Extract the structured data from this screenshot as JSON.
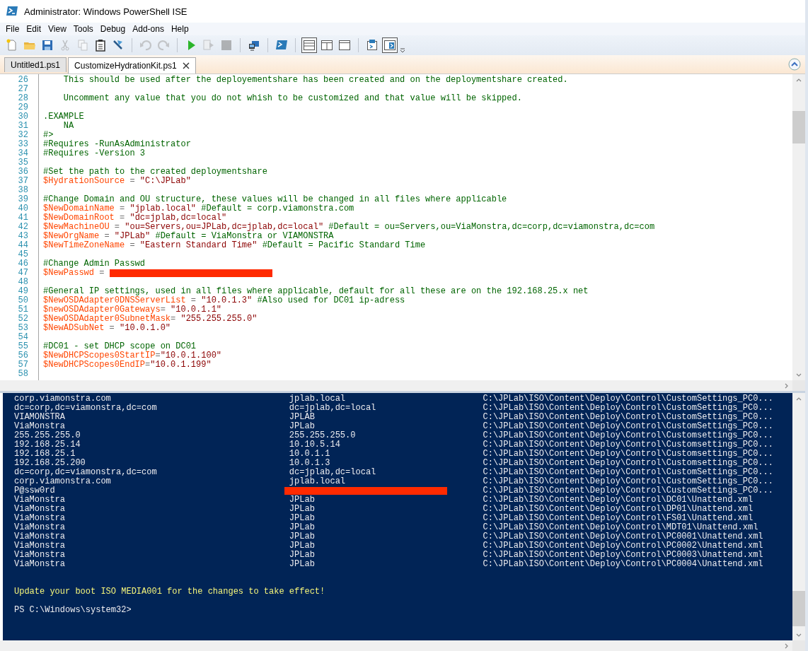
{
  "window": {
    "title": "Administrator: Windows PowerShell ISE"
  },
  "menu": [
    "File",
    "Edit",
    "View",
    "Tools",
    "Debug",
    "Add-ons",
    "Help"
  ],
  "toolbar": [
    {
      "kind": "new",
      "disabled": false,
      "pressed": false
    },
    {
      "kind": "open",
      "disabled": false,
      "pressed": false
    },
    {
      "kind": "save",
      "disabled": false,
      "pressed": false
    },
    {
      "kind": "cut",
      "disabled": true,
      "pressed": false
    },
    {
      "kind": "copy",
      "disabled": true,
      "pressed": false
    },
    {
      "kind": "paste",
      "disabled": false,
      "pressed": false
    },
    {
      "kind": "clear",
      "disabled": false,
      "pressed": false
    },
    {
      "kind": "separator"
    },
    {
      "kind": "undo",
      "disabled": true,
      "pressed": false
    },
    {
      "kind": "redo",
      "disabled": true,
      "pressed": false
    },
    {
      "kind": "separator"
    },
    {
      "kind": "run",
      "disabled": false,
      "pressed": false
    },
    {
      "kind": "run-selection",
      "disabled": true,
      "pressed": false
    },
    {
      "kind": "stop",
      "disabled": true,
      "pressed": false
    },
    {
      "kind": "separator"
    },
    {
      "kind": "remote",
      "disabled": false,
      "pressed": false
    },
    {
      "kind": "separator"
    },
    {
      "kind": "console",
      "disabled": false,
      "pressed": false
    },
    {
      "kind": "separator"
    },
    {
      "kind": "layout-top",
      "disabled": false,
      "pressed": true
    },
    {
      "kind": "layout-right",
      "disabled": false,
      "pressed": false
    },
    {
      "kind": "layout-max",
      "disabled": false,
      "pressed": false
    },
    {
      "kind": "separator"
    },
    {
      "kind": "show-script",
      "disabled": false,
      "pressed": false
    },
    {
      "kind": "show-addon",
      "disabled": false,
      "pressed": true
    },
    {
      "kind": "overflow"
    }
  ],
  "tabs": [
    {
      "label": "Untitled1.ps1",
      "selected": false,
      "closable": false
    },
    {
      "label": "CustomizeHydrationKit.ps1",
      "selected": true,
      "closable": true
    }
  ],
  "editor": {
    "lines": [
      {
        "number": "26",
        "tokens": [
          {
            "kind": "comment",
            "text": "    This should be used after the deployementshare has been created and on the deploymentshare created."
          }
        ]
      },
      {
        "number": "27"
      },
      {
        "number": "28",
        "tokens": [
          {
            "kind": "comment",
            "text": "    Uncomment any value that you do not whish to be customized and that value will be skipped."
          }
        ]
      },
      {
        "number": "29"
      },
      {
        "number": "30",
        "tokens": [
          {
            "kind": "comment",
            "text": ".EXAMPLE"
          }
        ]
      },
      {
        "number": "31",
        "tokens": [
          {
            "kind": "comment",
            "text": "    NA"
          }
        ]
      },
      {
        "number": "32",
        "tokens": [
          {
            "kind": "comment",
            "text": "#>"
          }
        ]
      },
      {
        "number": "33",
        "tokens": [
          {
            "kind": "comment",
            "text": "#Requires -RunAsAdministrator"
          }
        ]
      },
      {
        "number": "34",
        "tokens": [
          {
            "kind": "comment",
            "text": "#Requires -Version 3"
          }
        ]
      },
      {
        "number": "35"
      },
      {
        "number": "36",
        "tokens": [
          {
            "kind": "comment",
            "text": "#Set the path to the created deploymentshare"
          }
        ]
      },
      {
        "number": "37",
        "tokens": [
          {
            "kind": "variable",
            "text": "$HydrationSource"
          },
          {
            "kind": "operator",
            "text": " = "
          },
          {
            "kind": "string",
            "text": "\"C:\\JPLab\""
          }
        ]
      },
      {
        "number": "38"
      },
      {
        "number": "39",
        "tokens": [
          {
            "kind": "comment",
            "text": "#Change Domain and OU structure, these values will be changed in all files where applicable"
          }
        ]
      },
      {
        "number": "40",
        "tokens": [
          {
            "kind": "variable",
            "text": "$NewDomainName"
          },
          {
            "kind": "operator",
            "text": " = "
          },
          {
            "kind": "string",
            "text": "\"jplab.local\""
          },
          {
            "kind": "comment",
            "text": " #Default = corp.viamonstra.com"
          }
        ]
      },
      {
        "number": "41",
        "tokens": [
          {
            "kind": "variable",
            "text": "$NewDomainRoot"
          },
          {
            "kind": "operator",
            "text": " = "
          },
          {
            "kind": "string",
            "text": "\"dc=jplab,dc=local\""
          }
        ]
      },
      {
        "number": "42",
        "tokens": [
          {
            "kind": "variable",
            "text": "$NewMachineOU"
          },
          {
            "kind": "operator",
            "text": " = "
          },
          {
            "kind": "string",
            "text": "\"ou=Servers,ou=JPLab,dc=jplab,dc=local\""
          },
          {
            "kind": "comment",
            "text": " #Default = ou=Servers,ou=ViaMonstra,dc=corp,dc=viamonstra,dc=com"
          }
        ]
      },
      {
        "number": "43",
        "tokens": [
          {
            "kind": "variable",
            "text": "$NewOrgName"
          },
          {
            "kind": "operator",
            "text": " = "
          },
          {
            "kind": "string",
            "text": "\"JPLab\""
          },
          {
            "kind": "comment",
            "text": " #Default = ViaMonstra or VIAMONSTRA"
          }
        ]
      },
      {
        "number": "44",
        "tokens": [
          {
            "kind": "variable",
            "text": "$NewTimeZoneName"
          },
          {
            "kind": "operator",
            "text": " = "
          },
          {
            "kind": "string",
            "text": "\"Eastern Standard Time\""
          },
          {
            "kind": "comment",
            "text": " #Default = Pacific Standard Time"
          }
        ]
      },
      {
        "number": "45"
      },
      {
        "number": "46",
        "tokens": [
          {
            "kind": "comment",
            "text": "#Change Admin Passwd"
          }
        ]
      },
      {
        "number": "47",
        "tokens": [
          {
            "kind": "variable",
            "text": "$NewPasswd"
          },
          {
            "kind": "operator",
            "text": " = "
          },
          {
            "kind": "redaction"
          }
        ]
      },
      {
        "number": "48"
      },
      {
        "number": "49",
        "tokens": [
          {
            "kind": "comment",
            "text": "#General IP settings, used in all files where applicable, default for all these are on the 192.168.25.x net"
          }
        ]
      },
      {
        "number": "50",
        "tokens": [
          {
            "kind": "variable",
            "text": "$NewOSDAdapter0DNSServerList"
          },
          {
            "kind": "operator",
            "text": " = "
          },
          {
            "kind": "string",
            "text": "\"10.0.1.3\""
          },
          {
            "kind": "comment",
            "text": " #Also used for DC01 ip-adress"
          }
        ]
      },
      {
        "number": "51",
        "tokens": [
          {
            "kind": "variable",
            "text": "$newOSDAdapter0Gateways"
          },
          {
            "kind": "operator",
            "text": "= "
          },
          {
            "kind": "string",
            "text": "\"10.0.1.1\""
          }
        ]
      },
      {
        "number": "52",
        "tokens": [
          {
            "kind": "variable",
            "text": "$NewOSDAdapter0SubnetMask"
          },
          {
            "kind": "operator",
            "text": "= "
          },
          {
            "kind": "string",
            "text": "\"255.255.255.0\""
          }
        ]
      },
      {
        "number": "53",
        "tokens": [
          {
            "kind": "variable",
            "text": "$NewADSubNet"
          },
          {
            "kind": "operator",
            "text": " = "
          },
          {
            "kind": "string",
            "text": "\"10.0.1.0\""
          }
        ]
      },
      {
        "number": "54"
      },
      {
        "number": "55",
        "tokens": [
          {
            "kind": "comment",
            "text": "#DC01 - set DHCP scope on DC01"
          }
        ]
      },
      {
        "number": "56",
        "tokens": [
          {
            "kind": "variable",
            "text": "$NewDHCPScopes0StartIP"
          },
          {
            "kind": "operator",
            "text": "="
          },
          {
            "kind": "string",
            "text": "\"10.0.1.100\""
          }
        ]
      },
      {
        "number": "57",
        "tokens": [
          {
            "kind": "variable",
            "text": "$NewDHCPScopes0EndIP"
          },
          {
            "kind": "operator",
            "text": "="
          },
          {
            "kind": "string",
            "text": "\"10.0.1.199\""
          }
        ]
      },
      {
        "number": "58"
      }
    ]
  },
  "console": {
    "rows": [
      {
        "column_1": "corp.viamonstra.com",
        "column_2": "jplab.local",
        "column_3": "C:\\JPLab\\ISO\\Content\\Deploy\\Control\\CustomSettings_PC0..."
      },
      {
        "column_1": "dc=corp,dc=viamonstra,dc=com",
        "column_2": "dc=jplab,dc=local",
        "column_3": "C:\\JPLab\\ISO\\Content\\Deploy\\Control\\CustomSettings_PC0..."
      },
      {
        "column_1": "VIAMONSTRA",
        "column_2": "JPLAB",
        "column_3": "C:\\JPLab\\ISO\\Content\\Deploy\\Control\\CustomSettings_PC0..."
      },
      {
        "column_1": "ViaMonstra",
        "column_2": "JPLab",
        "column_3": "C:\\JPLab\\ISO\\Content\\Deploy\\Control\\CustomSettings_PC0..."
      },
      {
        "column_1": "255.255.255.0",
        "column_2": "255.255.255.0",
        "column_3": "C:\\JPLab\\ISO\\Content\\Deploy\\Control\\Customsettings_PC0..."
      },
      {
        "column_1": "192.168.25.14",
        "column_2": "10.10.5.14",
        "column_3": "C:\\JPLab\\ISO\\Content\\Deploy\\Control\\Customsettings_PC0..."
      },
      {
        "column_1": "192.168.25.1",
        "column_2": "10.0.1.1",
        "column_3": "C:\\JPLab\\ISO\\Content\\Deploy\\Control\\Customsettings_PC0..."
      },
      {
        "column_1": "192.168.25.200",
        "column_2": "10.0.1.3",
        "column_3": "C:\\JPLab\\ISO\\Content\\Deploy\\Control\\Customsettings_PC0..."
      },
      {
        "column_1": "dc=corp,dc=viamonstra,dc=com",
        "column_2": "dc=jplab,dc=local",
        "column_3": "C:\\JPLab\\ISO\\Content\\Deploy\\Control\\CustomSettings_PC0..."
      },
      {
        "column_1": "corp.viamonstra.com",
        "column_2": "jplab.local",
        "column_3": "C:\\JPLab\\ISO\\Content\\Deploy\\Control\\CustomSettings_PC0..."
      },
      {
        "column_1": "P@ssw0rd",
        "column_2_redacted": true,
        "column_3": "C:\\JPLab\\ISO\\Content\\Deploy\\Control\\CustomSettings_PC0..."
      },
      {
        "column_1": "ViaMonstra",
        "column_2": "JPLab",
        "column_3": "C:\\JPLab\\ISO\\Content\\Deploy\\Control\\DC01\\Unattend.xml"
      },
      {
        "column_1": "ViaMonstra",
        "column_2": "JPLab",
        "column_3": "C:\\JPLab\\ISO\\Content\\Deploy\\Control\\DP01\\Unattend.xml"
      },
      {
        "column_1": "ViaMonstra",
        "column_2": "JPLab",
        "column_3": "C:\\JPLab\\ISO\\Content\\Deploy\\Control\\FS01\\Unattend.xml"
      },
      {
        "column_1": "ViaMonstra",
        "column_2": "JPLab",
        "column_3": "C:\\JPLab\\ISO\\Content\\Deploy\\Control\\MDT01\\Unattend.xml"
      },
      {
        "column_1": "ViaMonstra",
        "column_2": "JPLab",
        "column_3": "C:\\JPLab\\ISO\\Content\\Deploy\\Control\\PC0001\\Unattend.xml"
      },
      {
        "column_1": "ViaMonstra",
        "column_2": "JPLab",
        "column_3": "C:\\JPLab\\ISO\\Content\\Deploy\\Control\\PC0002\\Unattend.xml"
      },
      {
        "column_1": "ViaMonstra",
        "column_2": "JPLab",
        "column_3": "C:\\JPLab\\ISO\\Content\\Deploy\\Control\\PC0003\\Unattend.xml"
      },
      {
        "column_1": "ViaMonstra",
        "column_2": "JPLab",
        "column_3": "C:\\JPLab\\ISO\\Content\\Deploy\\Control\\PC0004\\Unattend.xml"
      }
    ],
    "messages": [
      {
        "kind": "warning",
        "text": "Update your boot ISO MEDIA001 for the changes to take effect!"
      },
      {
        "kind": "prompt",
        "text": "PS C:\\Windows\\system32>"
      }
    ]
  }
}
